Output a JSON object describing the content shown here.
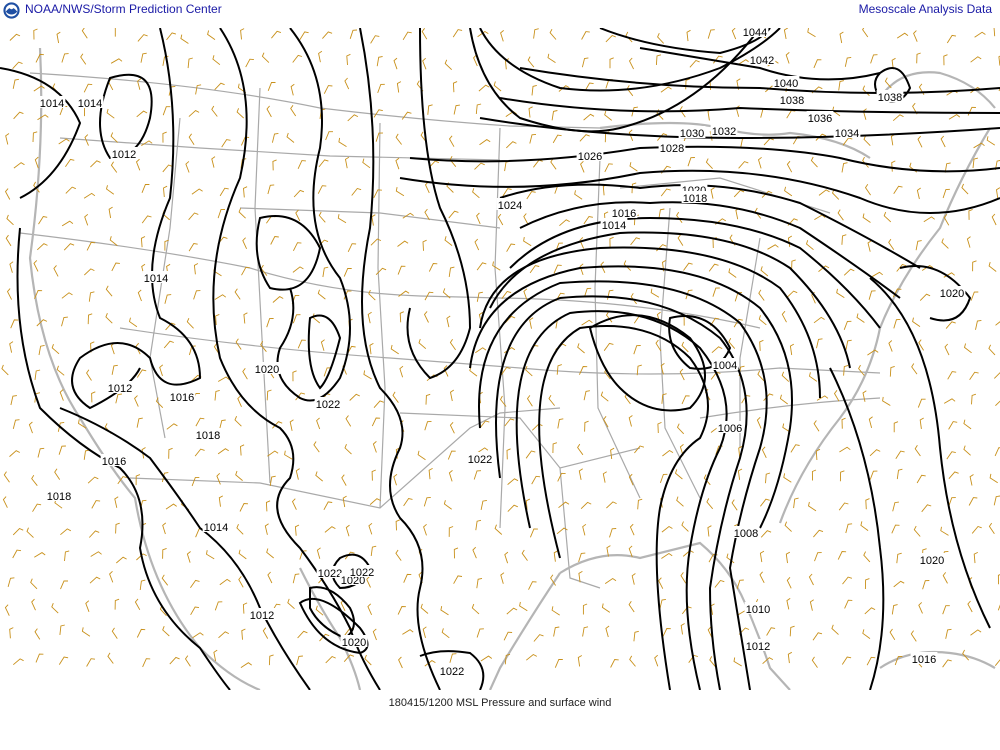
{
  "header": {
    "agency": "NOAA/NWS/Storm Prediction Center",
    "product": "Mesoscale Analysis Data"
  },
  "caption": "180415/1200 MSL Pressure and surface wind",
  "colors": {
    "isobar": "#000000",
    "wind_barb": "#c8901a",
    "border": "#a9a9a9",
    "header_text": "#1a1aa6"
  },
  "icons": {
    "logo": "noaa-logo-icon"
  },
  "isobar_labels": [
    {
      "id": "l1044",
      "text": "1044"
    },
    {
      "id": "l1042",
      "text": "1042"
    },
    {
      "id": "l1040",
      "text": "1040"
    },
    {
      "id": "l1038a",
      "text": "1038"
    },
    {
      "id": "l1038b",
      "text": "1038"
    },
    {
      "id": "l1036",
      "text": "1036"
    },
    {
      "id": "l1034",
      "text": "1034"
    },
    {
      "id": "l1032",
      "text": "1032"
    },
    {
      "id": "l1030",
      "text": "1030"
    },
    {
      "id": "l1028",
      "text": "1028"
    },
    {
      "id": "l1026",
      "text": "1026"
    },
    {
      "id": "l1024",
      "text": "1024"
    },
    {
      "id": "l1020n",
      "text": "1020"
    },
    {
      "id": "l1018n",
      "text": "1018"
    },
    {
      "id": "l1016n",
      "text": "1016"
    },
    {
      "id": "l1014n",
      "text": "1014"
    },
    {
      "id": "l1014a",
      "text": "1014"
    },
    {
      "id": "l1014b",
      "text": "1014"
    },
    {
      "id": "l1012a",
      "text": "1012"
    },
    {
      "id": "l1014c",
      "text": "1014"
    },
    {
      "id": "l1012b",
      "text": "1012"
    },
    {
      "id": "l1020a",
      "text": "1020"
    },
    {
      "id": "l1016a",
      "text": "1016"
    },
    {
      "id": "l1018a",
      "text": "1018"
    },
    {
      "id": "l1022a",
      "text": "1022"
    },
    {
      "id": "l1016b",
      "text": "1016"
    },
    {
      "id": "l1018b",
      "text": "1018"
    },
    {
      "id": "l1014d",
      "text": "1014"
    },
    {
      "id": "l1022b",
      "text": "1022"
    },
    {
      "id": "l1022c",
      "text": "1022"
    },
    {
      "id": "l1020b",
      "text": "1020"
    },
    {
      "id": "l1022d",
      "text": "1022"
    },
    {
      "id": "l1020c",
      "text": "1020"
    },
    {
      "id": "l1012c",
      "text": "1012"
    },
    {
      "id": "l1022e",
      "text": "1022"
    },
    {
      "id": "l1004",
      "text": "1004"
    },
    {
      "id": "l1006",
      "text": "1006"
    },
    {
      "id": "l1008",
      "text": "1008"
    },
    {
      "id": "l1010",
      "text": "1010"
    },
    {
      "id": "l1012d",
      "text": "1012"
    },
    {
      "id": "l1020e",
      "text": "1020"
    },
    {
      "id": "l1020f",
      "text": "1020"
    },
    {
      "id": "l1016c",
      "text": "1016"
    }
  ]
}
